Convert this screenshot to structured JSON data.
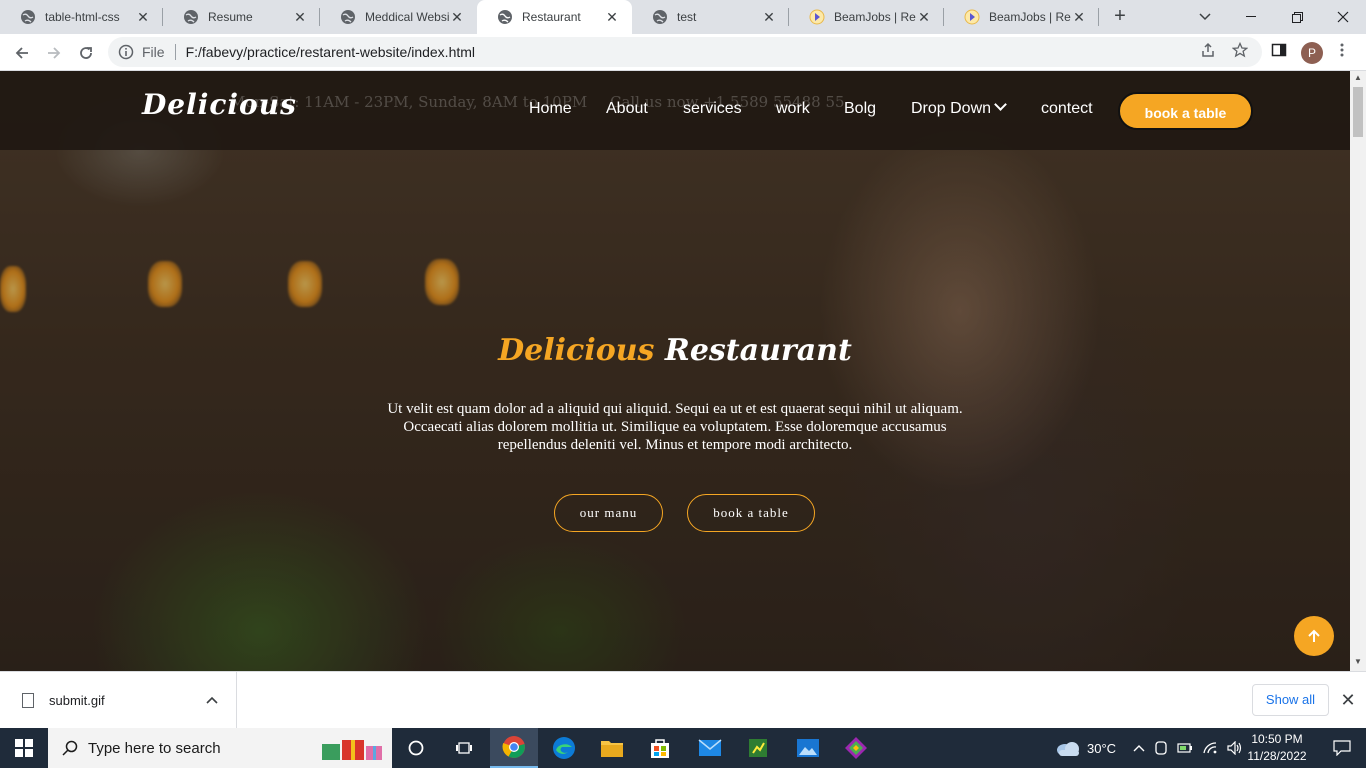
{
  "browser": {
    "tabs": [
      {
        "label": "table-html-css"
      },
      {
        "label": "Resume"
      },
      {
        "label": "Meddical Website"
      },
      {
        "label": "Restaurant"
      },
      {
        "label": "test"
      },
      {
        "label": "BeamJobs | Resume"
      },
      {
        "label": "BeamJobs | Resume"
      }
    ],
    "address": {
      "scheme": "File",
      "url": "F:/fabevy/practice/restarent-website/index.html"
    },
    "profile_initial": "P"
  },
  "page": {
    "topbar": {
      "hours": "Mon-Sat: 11AM - 23PM, Sunday, 8AM to 10PM",
      "phone": "Call us now +1 5589 55488 55"
    },
    "logo": "Delicious",
    "nav": [
      "Home",
      "About",
      "services",
      "work",
      "Bolg",
      "Drop Down",
      "contect"
    ],
    "cta": "book a table",
    "hero": {
      "title_accent": "Delicious",
      "title_rest": "Restaurant",
      "text": "Ut velit est quam dolor ad a aliquid qui aliquid. Sequi ea ut et est quaerat sequi nihil ut aliquam. Occaecati alias dolorem mollitia ut. Similique ea voluptatem. Esse doloremque accusamus repellendus deleniti vel. Minus et tempore modi architecto.",
      "btn_menu": "our manu",
      "btn_book": "book a table"
    },
    "accent_color": "#f5a623"
  },
  "downloads": {
    "file": "submit.gif",
    "show_all": "Show all"
  },
  "taskbar": {
    "search_placeholder": "Type here to search",
    "weather": "30°C",
    "time": "10:50 PM",
    "date": "11/28/2022"
  }
}
